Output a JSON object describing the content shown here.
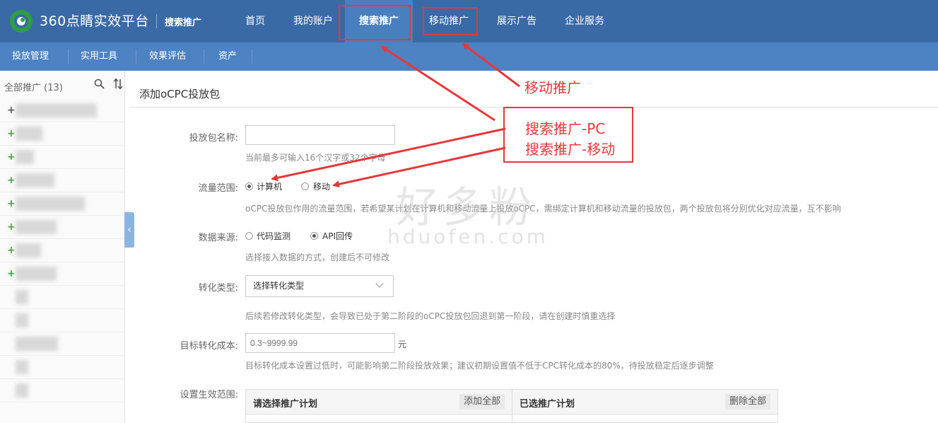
{
  "header": {
    "brand": "360点睛实效平台",
    "product": "搜索推广",
    "nav": [
      "首页",
      "我的账户",
      "搜索推广",
      "移动推广",
      "展示广告",
      "企业服务"
    ],
    "active_nav": "搜索推广"
  },
  "subnav": [
    "投放管理",
    "实用工具",
    "效果评估",
    "资产"
  ],
  "sidebar": {
    "title": "全部推广 (13)",
    "icons": [
      "search-icon",
      "sort-icon"
    ]
  },
  "form": {
    "title": "添加oCPC投放包",
    "package_name": {
      "label": "投放包名称:",
      "value": "",
      "hint": "当前最多可输入16个汉字或32个字母"
    },
    "traffic_scope": {
      "label": "流量范围:",
      "options": [
        "计算机",
        "移动"
      ],
      "selected": "计算机",
      "hint": "oCPC投放包作用的流量范围，若希望某计划在计算机和移动流量上投放oCPC，需绑定计算机和移动流量的投放包，两个投放包将分别优化对应流量，互不影响"
    },
    "data_source": {
      "label": "数据来源:",
      "options": [
        "代码监测",
        "API回传"
      ],
      "selected": "API回传",
      "hint": "选择接入数据的方式，创建后不可修改"
    },
    "conversion_type": {
      "label": "转化类型:",
      "placeholder": "选择转化类型",
      "hint": "后续若修改转化类型，会导致已处于第二阶段的oCPC投放包回退到第一阶段，请在创建时慎重选择"
    },
    "target_cost": {
      "label": "目标转化成本:",
      "placeholder": "0.3~9999.99",
      "unit": "元",
      "hint": "目标转化成本设置过低时，可能影响第二阶段投放效果；建议初期设置值不低于CPC转化成本的80%，待投放稳定后逐步调整"
    },
    "scope": {
      "label": "设置生效范围:",
      "left_title": "请选择推广计划",
      "left_button": "添加全部",
      "right_title": "已选推广计划",
      "right_button": "删除全部"
    }
  },
  "annotations": {
    "mobile": "移动推广",
    "search_pc": "搜索推广-PC",
    "search_mobile": "搜索推广-移动"
  },
  "watermark": {
    "text": "好多粉",
    "url": "hduofen.com"
  },
  "colors": {
    "topbar": "#3a6aa6",
    "subbar": "#4d82c3",
    "annotation": "#e5383b"
  }
}
